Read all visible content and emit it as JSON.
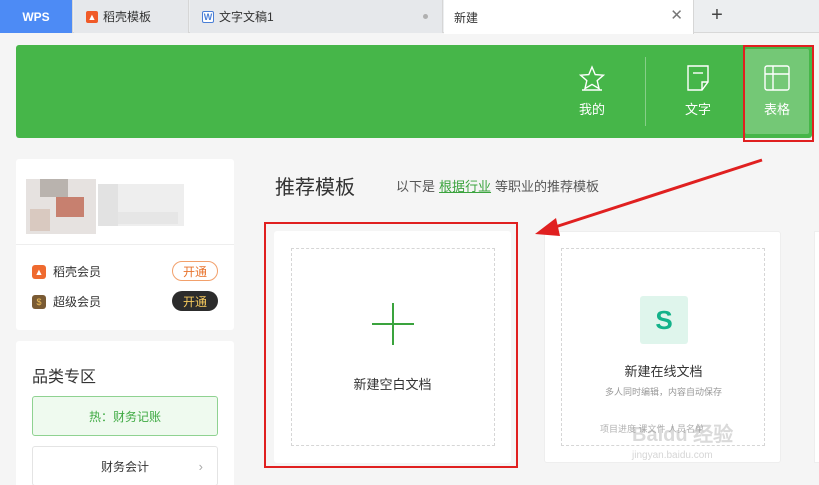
{
  "tabs": {
    "wps": "WPS",
    "daoke": "稻壳模板",
    "doc": "文字文稿1",
    "new": "新建",
    "add": "+",
    "close": "✕"
  },
  "header": {
    "mine": "我的",
    "text": "文字",
    "sheet": "表格",
    "accent_color": "#46b649"
  },
  "sidebar": {
    "members": [
      {
        "label": "稻壳会员",
        "action": "开通",
        "icon": "daoke-icon"
      },
      {
        "label": "超级会员",
        "action": "开通",
        "icon": "super-member-icon"
      }
    ],
    "category": {
      "title": "品类专区",
      "hot": "热：财务记账",
      "item": "财务会计"
    }
  },
  "main": {
    "title": "推荐模板",
    "subtitle_prefix": "以下是",
    "subtitle_link": "根据行业",
    "subtitle_suffix": "等职业的推荐模板",
    "blank_doc": "新建空白文档",
    "online_doc": "新建在线文档",
    "online_desc": "多人同时编辑，内容自动保存",
    "online_foot": "项目进度  课文件  人员名单"
  },
  "watermark": {
    "brand": "Baidu 经验",
    "url": "jingyan.baidu.com"
  }
}
